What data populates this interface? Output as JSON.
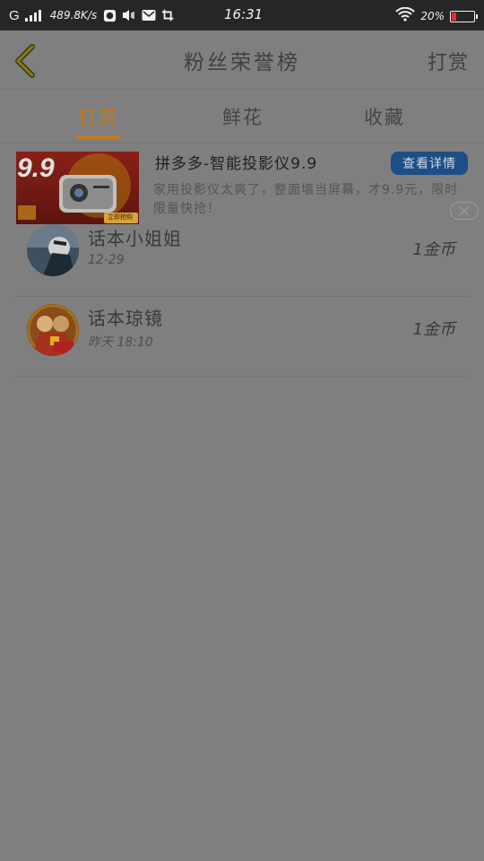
{
  "status_bar": {
    "network": "G",
    "speed": "489.8K/s",
    "time": "16:31",
    "battery_pct": "20%",
    "battery_level": 0.2,
    "icons": [
      "signal-icon",
      "browser-icon",
      "volume-icon",
      "mail-icon",
      "screenshot-icon",
      "wifi-icon",
      "battery-icon"
    ]
  },
  "header": {
    "title": "粉丝荣誉榜",
    "action": "打赏",
    "back_icon": "chevron-left-icon"
  },
  "tabs": [
    {
      "label": "打赏",
      "active": true
    },
    {
      "label": "鲜花",
      "active": false
    },
    {
      "label": "收藏",
      "active": false
    }
  ],
  "ad": {
    "price_tag": "9.9",
    "image_caption": "立即抢购",
    "title": "拼多多-智能投影仪9.9",
    "button": "查看详情",
    "description": "家用投影仪太爽了，整面墙当屏幕，才9.9元，限时限量快抢！",
    "close_icon": "close-icon"
  },
  "list": [
    {
      "name": "话本小姐姐",
      "date": "12-29",
      "amount": "1金币"
    },
    {
      "name": "话本琼镜",
      "date": "昨天 18:10",
      "amount": "1金币"
    }
  ],
  "colors": {
    "accent": "#c07a1f",
    "overlay": "#7f7f7f",
    "status_bar": "#262626",
    "ad_button": "#1d4f86"
  }
}
